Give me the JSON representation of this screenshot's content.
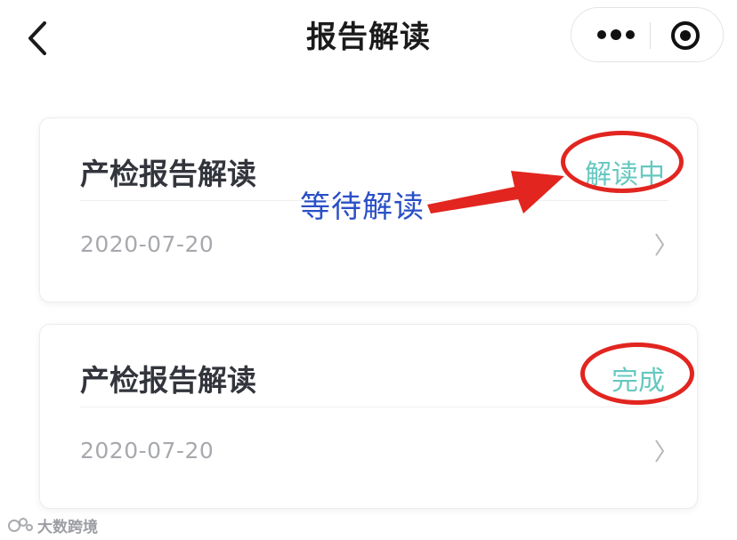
{
  "nav": {
    "title": "报告解读",
    "icons": {
      "back": "chevron-left-icon",
      "more": "more-dots-icon",
      "record": "record-circle-icon"
    }
  },
  "cards": [
    {
      "title": "产检报告解读",
      "status": "解读中",
      "date": "2020-07-20"
    },
    {
      "title": "产检报告解读",
      "status": "完成",
      "date": "2020-07-20"
    }
  ],
  "annotation": {
    "text": "等待解读",
    "color": "#e2251f",
    "text_color": "#2a4fc7"
  },
  "watermark": {
    "text": "大数跨境"
  },
  "colors": {
    "status": "#66c8c0",
    "date": "#a7a9ae",
    "title": "#33353d"
  }
}
